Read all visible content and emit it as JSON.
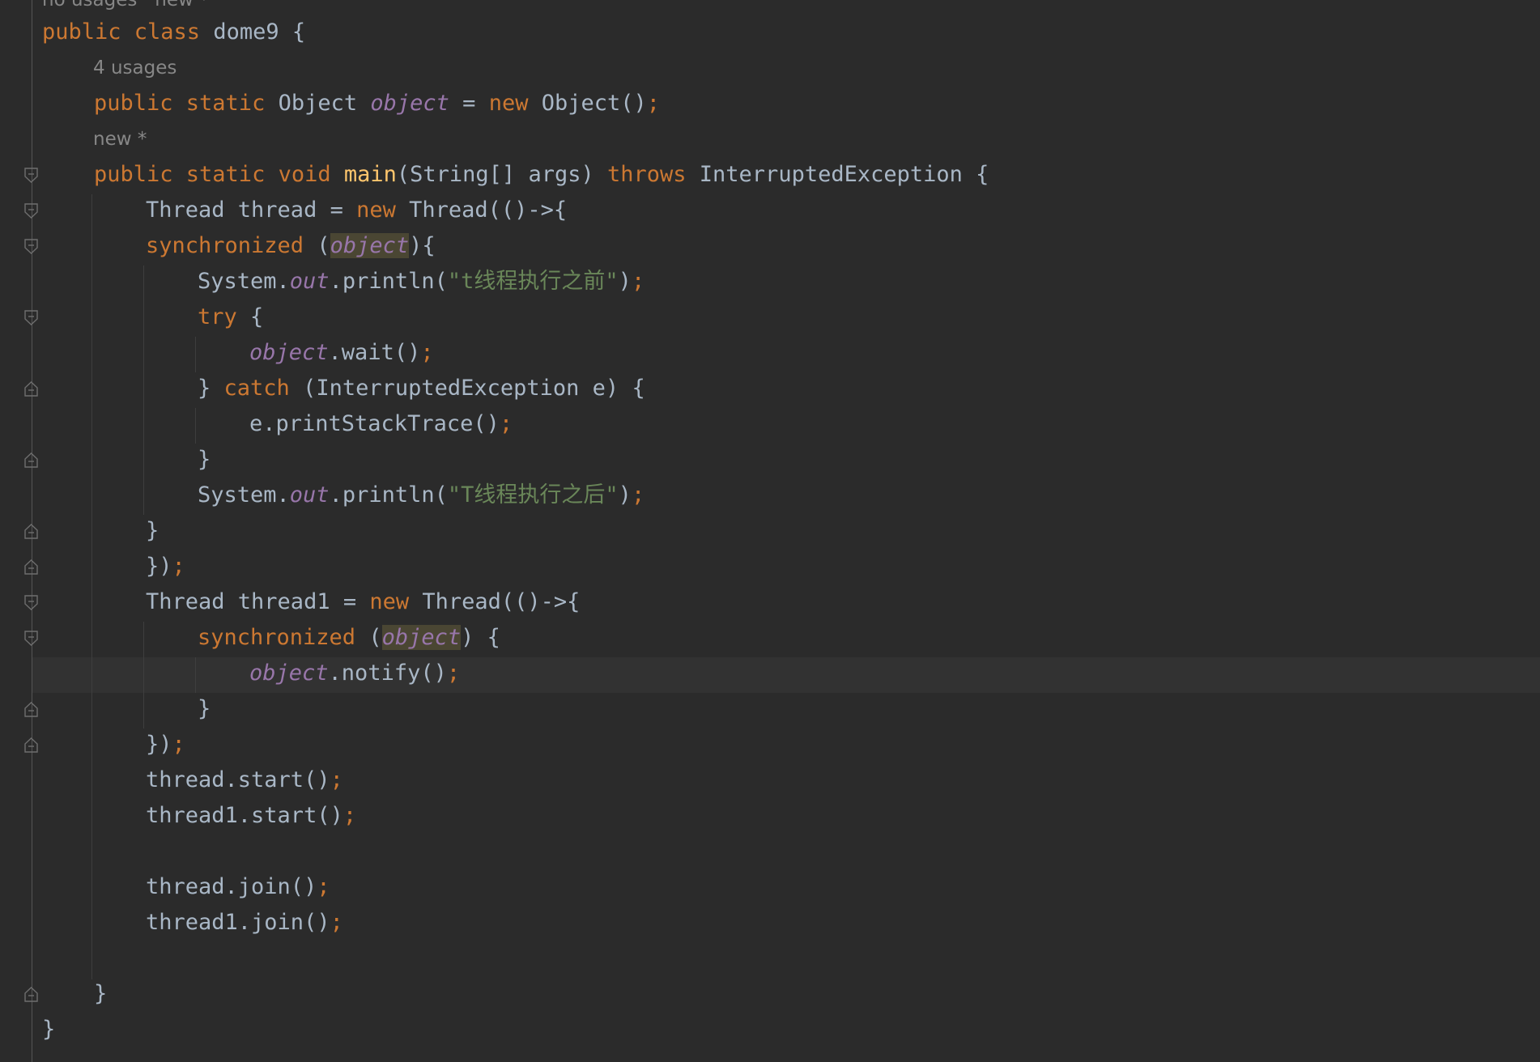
{
  "editor": {
    "hints": {
      "top": "no usages   new *",
      "field": "4 usages",
      "method": "new *"
    },
    "lines": [
      [
        {
          "t": "public class ",
          "c": "kw"
        },
        {
          "t": "dome9 {"
        }
      ],
      [
        {
          "t": "public static ",
          "c": "kw"
        },
        {
          "t": "Object "
        },
        {
          "t": "object",
          "c": "fld"
        },
        {
          "t": " = "
        },
        {
          "t": "new ",
          "c": "kw"
        },
        {
          "t": "Object()"
        },
        {
          "t": ";",
          "c": "semi"
        }
      ],
      [
        {
          "t": "public static void ",
          "c": "kw"
        },
        {
          "t": "main",
          "c": "fn"
        },
        {
          "t": "(String[] args) "
        },
        {
          "t": "throws ",
          "c": "kw"
        },
        {
          "t": "InterruptedException {"
        }
      ],
      [
        {
          "t": "Thread thread = "
        },
        {
          "t": "new ",
          "c": "kw"
        },
        {
          "t": "Thread(()->{"
        }
      ],
      [
        {
          "t": "synchronized ",
          "c": "kw"
        },
        {
          "t": "("
        },
        {
          "t": "object",
          "c": "fld hl"
        },
        {
          "t": "){"
        }
      ],
      [
        {
          "t": "System."
        },
        {
          "t": "out",
          "c": "fld"
        },
        {
          "t": ".println("
        },
        {
          "t": "\"t线程执行之前\"",
          "c": "str"
        },
        {
          "t": ")"
        },
        {
          "t": ";",
          "c": "semi"
        }
      ],
      [
        {
          "t": "try ",
          "c": "kw"
        },
        {
          "t": "{"
        }
      ],
      [
        {
          "t": "object",
          "c": "fld"
        },
        {
          "t": ".wait()"
        },
        {
          "t": ";",
          "c": "semi"
        }
      ],
      [
        {
          "t": "} "
        },
        {
          "t": "catch ",
          "c": "kw"
        },
        {
          "t": "(InterruptedException e) {"
        }
      ],
      [
        {
          "t": "e.printStackTrace()"
        },
        {
          "t": ";",
          "c": "semi"
        }
      ],
      [
        {
          "t": "}"
        }
      ],
      [
        {
          "t": "System."
        },
        {
          "t": "out",
          "c": "fld"
        },
        {
          "t": ".println("
        },
        {
          "t": "\"T线程执行之后\"",
          "c": "str"
        },
        {
          "t": ")"
        },
        {
          "t": ";",
          "c": "semi"
        }
      ],
      [
        {
          "t": "}"
        }
      ],
      [
        {
          "t": "})"
        },
        {
          "t": ";",
          "c": "semi"
        }
      ],
      [
        {
          "t": "Thread thread1 = "
        },
        {
          "t": "new ",
          "c": "kw"
        },
        {
          "t": "Thread(()->{"
        }
      ],
      [
        {
          "t": "synchronized ",
          "c": "kw"
        },
        {
          "t": "("
        },
        {
          "t": "object",
          "c": "fld hl"
        },
        {
          "t": ") {"
        }
      ],
      [
        {
          "t": "object",
          "c": "fld"
        },
        {
          "t": ".notify()"
        },
        {
          "t": ";",
          "c": "semi"
        }
      ],
      [
        {
          "t": "}"
        }
      ],
      [
        {
          "t": "})"
        },
        {
          "t": ";",
          "c": "semi"
        }
      ],
      [
        {
          "t": "thread.start()"
        },
        {
          "t": ";",
          "c": "semi"
        }
      ],
      [
        {
          "t": "thread1.start()"
        },
        {
          "t": ";",
          "c": "semi"
        }
      ],
      [],
      [
        {
          "t": "thread.join()"
        },
        {
          "t": ";",
          "c": "semi"
        }
      ],
      [
        {
          "t": "thread1.join()"
        },
        {
          "t": ";",
          "c": "semi"
        }
      ],
      [],
      [
        {
          "t": "}"
        }
      ],
      [
        {
          "t": "}"
        }
      ]
    ]
  }
}
